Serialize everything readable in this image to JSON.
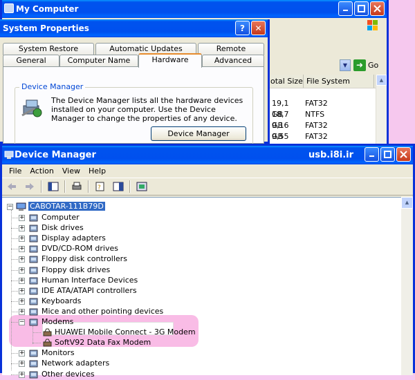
{
  "my_computer": {
    "title": "My Computer",
    "go_label": "Go",
    "columns": [
      "otal Size",
      "File System"
    ],
    "rows": [
      {
        "size": "19,1 GB",
        "fs": "FAT32"
      },
      {
        "size": "18,7 GB",
        "fs": "NTFS"
      },
      {
        "size": "9,16 GB",
        "fs": "FAT32"
      },
      {
        "size": "9,55 GB",
        "fs": "FAT32"
      }
    ]
  },
  "system_properties": {
    "title": "System Properties",
    "help_label": "?",
    "close_label": "✕",
    "tabs_row1": [
      "System Restore",
      "Automatic Updates",
      "Remote"
    ],
    "tabs_row2": [
      "General",
      "Computer Name",
      "Hardware",
      "Advanced"
    ],
    "active_tab": "Hardware",
    "group_title": "Device Manager",
    "group_text": "The Device Manager lists all the hardware devices installed on your computer. Use the Device Manager to change the properties of any device.",
    "button_label": "Device Manager"
  },
  "device_manager": {
    "title": "Device Manager",
    "watermark": "usb.i8i.ir",
    "menu": [
      "File",
      "Action",
      "View",
      "Help"
    ],
    "root": "CABOTAR-111B79D",
    "categories": [
      {
        "label": "Computer",
        "icon": "computer-icon"
      },
      {
        "label": "Disk drives",
        "icon": "disk-drive-icon"
      },
      {
        "label": "Display adapters",
        "icon": "display-adapter-icon"
      },
      {
        "label": "DVD/CD-ROM drives",
        "icon": "cdrom-icon"
      },
      {
        "label": "Floppy disk controllers",
        "icon": "floppy-controller-icon"
      },
      {
        "label": "Floppy disk drives",
        "icon": "floppy-drive-icon"
      },
      {
        "label": "Human Interface Devices",
        "icon": "hid-icon"
      },
      {
        "label": "IDE ATA/ATAPI controllers",
        "icon": "ide-controller-icon"
      },
      {
        "label": "Keyboards",
        "icon": "keyboard-icon"
      },
      {
        "label": "Mice and other pointing devices",
        "icon": "mouse-icon"
      },
      {
        "label": "Modems",
        "icon": "modem-icon"
      }
    ],
    "modems": [
      "HUAWEI Mobile Connect - 3G Modem",
      "SoftV92 Data Fax Modem"
    ],
    "after_modems": [
      {
        "label": "Monitors",
        "icon": "monitor-icon"
      },
      {
        "label": "Network adapters",
        "icon": "network-adapter-icon"
      },
      {
        "label": "Other devices",
        "icon": "other-devices-icon"
      }
    ]
  }
}
